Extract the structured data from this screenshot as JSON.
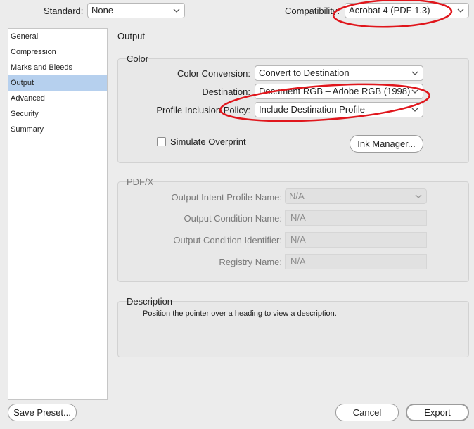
{
  "header": {
    "standard_label": "Standard:",
    "standard_value": "None",
    "compatibility_label": "Compatibility:",
    "compatibility_value": "Acrobat 4 (PDF 1.3)"
  },
  "sidebar": {
    "items": [
      {
        "label": "General"
      },
      {
        "label": "Compression"
      },
      {
        "label": "Marks and Bleeds"
      },
      {
        "label": "Output",
        "selected": true
      },
      {
        "label": "Advanced"
      },
      {
        "label": "Security"
      },
      {
        "label": "Summary"
      }
    ]
  },
  "main": {
    "section_title": "Output",
    "color": {
      "title": "Color",
      "color_conversion_label": "Color Conversion:",
      "color_conversion_value": "Convert to Destination",
      "destination_label": "Destination:",
      "destination_value": "Document RGB – Adobe RGB (1998)",
      "profile_inclusion_label": "Profile Inclusion Policy:",
      "profile_inclusion_value": "Include Destination Profile",
      "simulate_overprint_label": "Simulate Overprint",
      "simulate_overprint_checked": false,
      "ink_manager_label": "Ink Manager..."
    },
    "pdfx": {
      "title": "PDF/X",
      "intent_label": "Output Intent Profile Name:",
      "intent_value": "N/A",
      "condition_name_label": "Output Condition Name:",
      "condition_name_value": "N/A",
      "condition_id_label": "Output Condition Identifier:",
      "condition_id_value": "N/A",
      "registry_label": "Registry Name:",
      "registry_value": "N/A"
    },
    "description": {
      "title": "Description",
      "text": "Position the pointer over a heading to view a description."
    }
  },
  "footer": {
    "save_preset_label": "Save Preset...",
    "cancel_label": "Cancel",
    "export_label": "Export"
  },
  "colors": {
    "annotation_red": "#e0161c",
    "selection_blue": "#b6d0ee"
  }
}
